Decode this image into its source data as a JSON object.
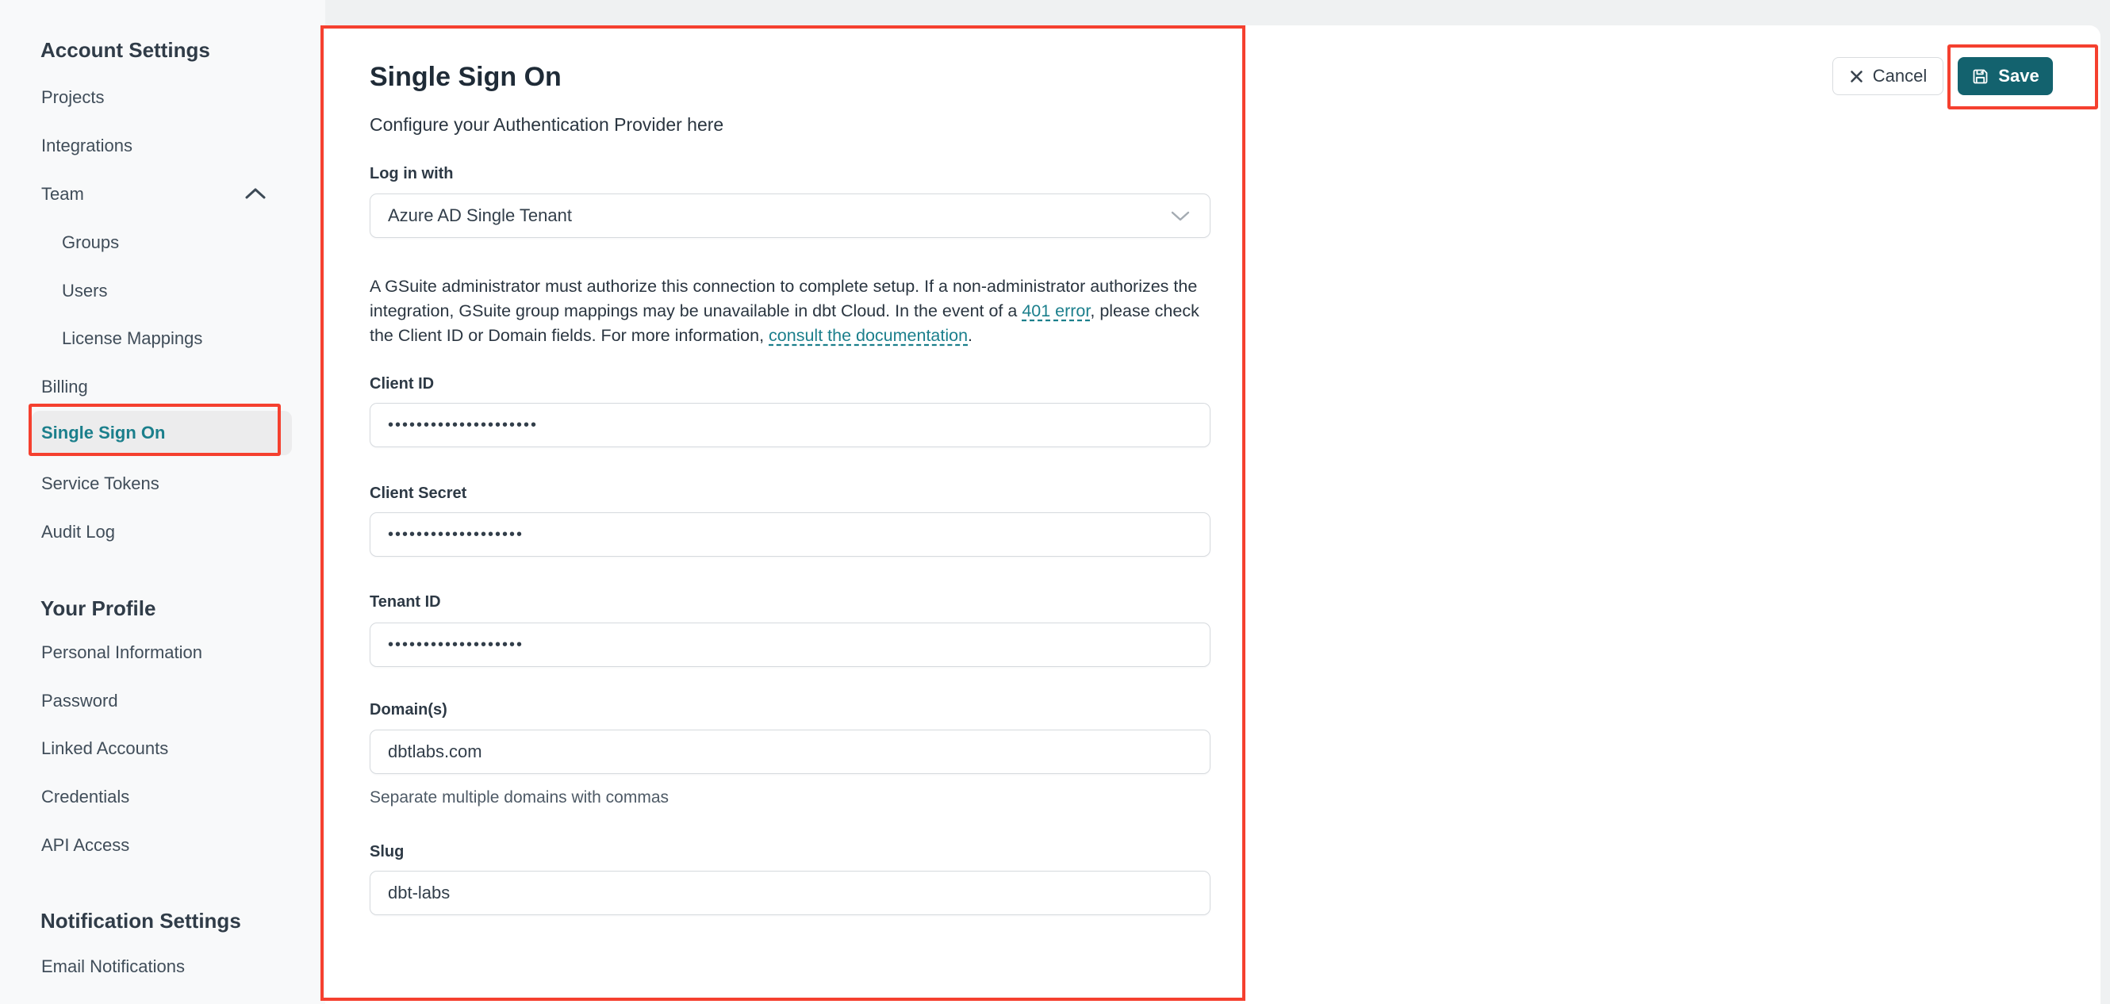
{
  "sidebar": {
    "account_settings_heading": "Account Settings",
    "projects": "Projects",
    "integrations": "Integrations",
    "team": "Team",
    "groups": "Groups",
    "users": "Users",
    "license_mappings": "License Mappings",
    "billing": "Billing",
    "single_sign_on": "Single Sign On",
    "service_tokens": "Service Tokens",
    "audit_log": "Audit Log",
    "your_profile_heading": "Your Profile",
    "personal_information": "Personal Information",
    "password": "Password",
    "linked_accounts": "Linked Accounts",
    "credentials": "Credentials",
    "api_access": "API Access",
    "notification_settings_heading": "Notification Settings",
    "email_notifications": "Email Notifications"
  },
  "sso_form": {
    "title": "Single Sign On",
    "subtitle": "Configure your Authentication Provider here",
    "login_with": {
      "label": "Log in with",
      "value": "Azure AD Single Tenant"
    },
    "notice": {
      "text_1": "A GSuite administrator must authorize this connection to complete setup. If a non-administrator authorizes the integration, GSuite group mappings may be unavailable in dbt Cloud. In the event of a ",
      "link_401": "401 error",
      "text_2": ", please check the Client ID or Domain fields. For more information, ",
      "link_docs": "consult the documentation",
      "text_3": "."
    },
    "client_id": {
      "label": "Client ID",
      "value": "•••••••••••••••••••••"
    },
    "client_secret": {
      "label": "Client Secret",
      "value": "•••••••••••••••••••"
    },
    "tenant_id": {
      "label": "Tenant ID",
      "value": "•••••••••••••••••••"
    },
    "domains": {
      "label": "Domain(s)",
      "value": "dbtlabs.com",
      "help": "Separate multiple domains with commas"
    },
    "slug": {
      "label": "Slug",
      "value": "dbt-labs"
    }
  },
  "actions": {
    "cancel": "Cancel",
    "save": "Save"
  },
  "icons": {
    "cancel": "x-icon",
    "save": "floppy-disk-icon",
    "team_toggle": "chevron-up-icon",
    "login_select": "chevron-down-icon"
  },
  "colors": {
    "annotation_red": "#f5402f",
    "accent_teal": "#13626e",
    "link_teal": "#1b7f8c",
    "sidebar_bg": "#f8f9fa",
    "main_bg": "#eff1f2",
    "pill_bg": "#ececed"
  }
}
